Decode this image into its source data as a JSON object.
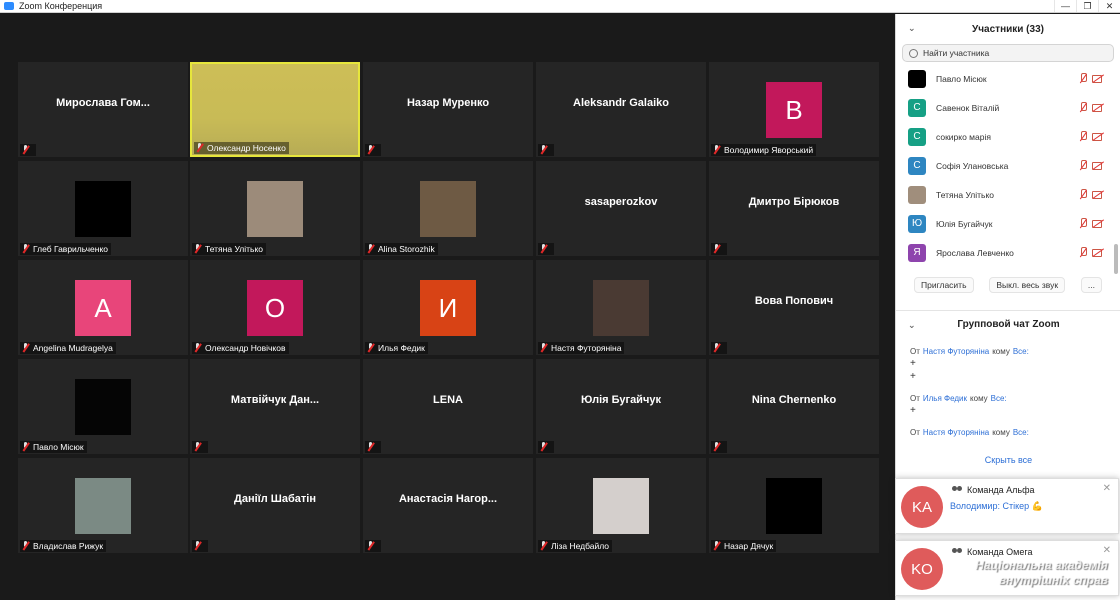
{
  "window": {
    "title": "Zoom Конференция",
    "controls": [
      "—",
      "❐",
      "✕"
    ]
  },
  "tiles": [
    {
      "label": "",
      "center": "Мирослава  Гом...",
      "photo": null
    },
    {
      "label": "Олександр Носенко",
      "center": "",
      "photo": "speaker"
    },
    {
      "label": "",
      "center": "Назар Муренко",
      "photo": null
    },
    {
      "label": "",
      "center": "Aleksandr Galaiko",
      "photo": null
    },
    {
      "label": "Володимир Яворський",
      "center": "",
      "photo": "letter",
      "letter": "В",
      "color": "#c2185b"
    },
    {
      "label": "Глеб Гаврильченко",
      "center": "",
      "photo": "black",
      "color": "#000000"
    },
    {
      "label": "Тетяна Улітько",
      "center": "",
      "photo": "image",
      "color": "#9c8b7a"
    },
    {
      "label": "Alina Storozhik",
      "center": "",
      "photo": "image",
      "color": "#6e5a44"
    },
    {
      "label": "",
      "center": "sasaperozkov",
      "photo": null
    },
    {
      "label": "",
      "center": "Дмитро Бірюков",
      "photo": null
    },
    {
      "label": "Angelina Mudragelya",
      "center": "",
      "photo": "letter",
      "letter": "A",
      "color": "#e8457a"
    },
    {
      "label": "Олександр Новічков",
      "center": "",
      "photo": "letter",
      "letter": "О",
      "color": "#c2185b"
    },
    {
      "label": "Илья Федик",
      "center": "",
      "photo": "letter",
      "letter": "И",
      "color": "#d84315"
    },
    {
      "label": "Настя Футоряніна",
      "center": "",
      "photo": "image",
      "color": "#4a3a33"
    },
    {
      "label": "",
      "center": "Вова Попович",
      "photo": null
    },
    {
      "label": "Павло Місюк",
      "center": "",
      "photo": "black",
      "color": "#050505"
    },
    {
      "label": "",
      "center": "Матвійчук  Дан...",
      "photo": null
    },
    {
      "label": "",
      "center": "LENA",
      "photo": null
    },
    {
      "label": "",
      "center": "Юлія Бугайчук",
      "photo": null
    },
    {
      "label": "",
      "center": "Nina Chernenko",
      "photo": null
    },
    {
      "label": "Владислав Рижук",
      "center": "",
      "photo": "image",
      "color": "#7b8a84"
    },
    {
      "label": "",
      "center": "Даніїл Шабатін",
      "photo": null
    },
    {
      "label": "",
      "center": "Анастасія  Нагор...",
      "photo": null
    },
    {
      "label": "Ліза Недбайло",
      "center": "",
      "photo": "image",
      "color": "#d4cfcc"
    },
    {
      "label": "Назар Дячук",
      "center": "",
      "photo": "black",
      "color": "#000000"
    }
  ],
  "participants": {
    "title": "Участники (33)",
    "search_placeholder": "Найти участника",
    "list": [
      {
        "name": "Павло Місюк",
        "avatar": "",
        "color": "#000000"
      },
      {
        "name": "Савенок Віталій",
        "avatar": "С",
        "color": "#16a085"
      },
      {
        "name": "сокирко марія",
        "avatar": "С",
        "color": "#16a085"
      },
      {
        "name": "Софія Улановська",
        "avatar": "С",
        "color": "#2e86c1"
      },
      {
        "name": "Тетяна Улітько",
        "avatar": "",
        "color": "#a08e7c"
      },
      {
        "name": "Юлія Бугайчук",
        "avatar": "Ю",
        "color": "#2e86c1"
      },
      {
        "name": "Ярослава Левченко",
        "avatar": "Я",
        "color": "#8e44ad"
      }
    ],
    "invite_label": "Пригласить",
    "mute_all_label": "Выкл. весь звук",
    "more_label": "..."
  },
  "chat": {
    "title": "Групповой чат Zoom",
    "from": "От",
    "to": "кому",
    "messages": [
      {
        "sender": "Настя Футоряніна",
        "recipient": "Все:",
        "lines": [
          "+",
          "+"
        ]
      },
      {
        "sender": "Илья Федик",
        "recipient": "Все:",
        "lines": [
          "+"
        ]
      },
      {
        "sender": "Настя Футоряніна",
        "recipient": "Все:",
        "lines": []
      }
    ],
    "show_all": "Скрыть все"
  },
  "notifications": [
    {
      "initials": "KA",
      "team": "Команда Альфа",
      "message": "Володимир: Стікер 💪"
    },
    {
      "initials": "KO",
      "team": "Команда Омега",
      "message": ""
    }
  ],
  "watermark": {
    "line1": "Національна академія",
    "line2": "внутрішніх справ"
  }
}
